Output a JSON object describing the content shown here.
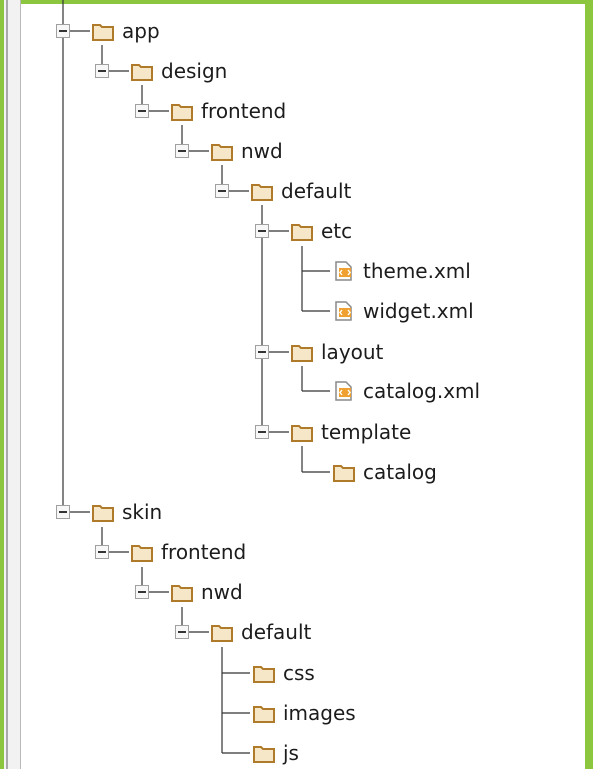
{
  "tree": [
    {
      "id": "app",
      "label": "app",
      "type": "folder",
      "toggle": true
    },
    {
      "id": "design",
      "label": "design",
      "type": "folder",
      "toggle": true
    },
    {
      "id": "frontend",
      "label": "frontend",
      "type": "folder",
      "toggle": true
    },
    {
      "id": "nwd",
      "label": "nwd",
      "type": "folder",
      "toggle": true
    },
    {
      "id": "default",
      "label": "default",
      "type": "folder",
      "toggle": true
    },
    {
      "id": "etc",
      "label": "etc",
      "type": "folder",
      "toggle": true
    },
    {
      "id": "theme-xml",
      "label": "theme.xml",
      "type": "xml",
      "toggle": false
    },
    {
      "id": "widget-xml",
      "label": "widget.xml",
      "type": "xml",
      "toggle": false
    },
    {
      "id": "layout",
      "label": "layout",
      "type": "folder",
      "toggle": true
    },
    {
      "id": "catalog-xml",
      "label": "catalog.xml",
      "type": "xml",
      "toggle": false
    },
    {
      "id": "template",
      "label": "template",
      "type": "folder",
      "toggle": true
    },
    {
      "id": "template-catalog",
      "label": "catalog",
      "type": "folder",
      "toggle": false
    },
    {
      "id": "skin",
      "label": "skin",
      "type": "folder",
      "toggle": true
    },
    {
      "id": "skin-frontend",
      "label": "frontend",
      "type": "folder",
      "toggle": true
    },
    {
      "id": "skin-nwd",
      "label": "nwd",
      "type": "folder",
      "toggle": true
    },
    {
      "id": "skin-default",
      "label": "default",
      "type": "folder",
      "toggle": true
    },
    {
      "id": "css",
      "label": "css",
      "type": "folder",
      "toggle": false
    },
    {
      "id": "images",
      "label": "images",
      "type": "folder",
      "toggle": false
    },
    {
      "id": "js",
      "label": "js",
      "type": "folder",
      "toggle": false
    }
  ],
  "colors": {
    "folder_stroke": "#b07a2b",
    "folder_fill": "#f5e7c8",
    "xml_badge": "#f0a030",
    "tree_line": "#333333",
    "window_accent": "#8cc63f"
  }
}
